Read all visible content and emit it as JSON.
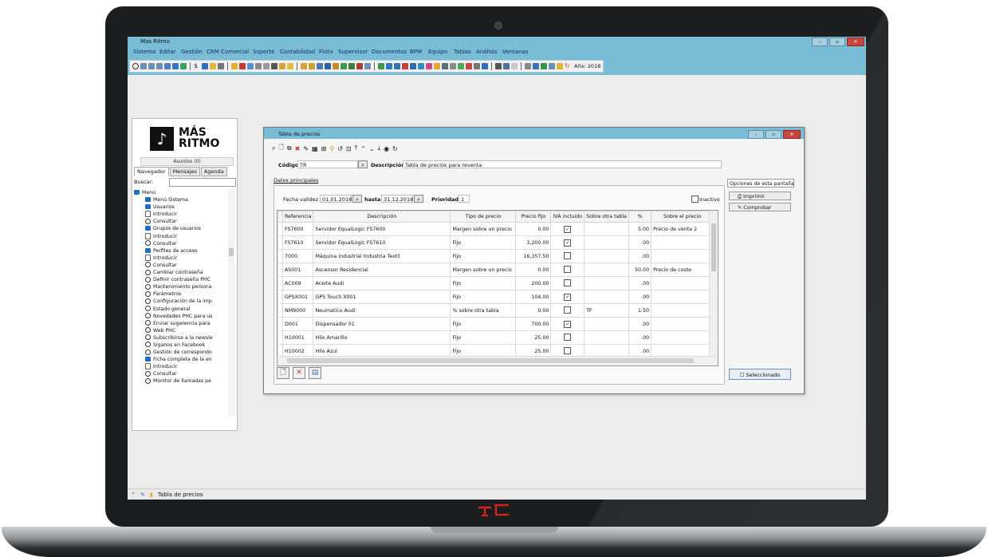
{
  "app": {
    "title": "Mas Ritmo",
    "menu": [
      "Sistema",
      "Editar",
      "Gestión",
      "CRM Comercial",
      "Soporte",
      "Contabilidad",
      "Flota",
      "Supervisor",
      "Documentos",
      "BPM",
      "Equipo",
      "Tablas",
      "Análisis",
      "Ventanas"
    ],
    "year_label": "Año: 2018"
  },
  "nav": {
    "logo_line1": "MÁS",
    "logo_line2": "RITMO",
    "asuntos": "Asuntos (0)",
    "tabs": [
      "Navegador",
      "Mensajes",
      "Agenda"
    ],
    "search_label": "Buscar:",
    "tree": [
      {
        "icon": "menu",
        "label": "Menú"
      },
      {
        "icon": "folder",
        "label": "Menú Sistema"
      },
      {
        "icon": "folder",
        "label": "Usuarios"
      },
      {
        "icon": "doc",
        "label": "Introducir"
      },
      {
        "icon": "circle",
        "label": "Consultar"
      },
      {
        "icon": "folder",
        "label": "Grupos de usuarios"
      },
      {
        "icon": "doc",
        "label": "Introducir"
      },
      {
        "icon": "circle",
        "label": "Consultar"
      },
      {
        "icon": "folder",
        "label": "Perfiles de acceso"
      },
      {
        "icon": "doc",
        "label": "Introducir"
      },
      {
        "icon": "circle",
        "label": "Consultar"
      },
      {
        "icon": "circle",
        "label": "Cambiar contraseña"
      },
      {
        "icon": "circle",
        "label": "Definir contraseña PHC"
      },
      {
        "icon": "circle",
        "label": "Mantenimiento persona"
      },
      {
        "icon": "circle",
        "label": "Parámetros"
      },
      {
        "icon": "circle",
        "label": "Configuración de la imp"
      },
      {
        "icon": "circle",
        "label": "Estado general"
      },
      {
        "icon": "circle",
        "label": "Novedades PHC para us"
      },
      {
        "icon": "circle",
        "label": "Enviar sugerencia para"
      },
      {
        "icon": "circle",
        "label": "Web PHC"
      },
      {
        "icon": "circle",
        "label": "Subscribirse a la newsle"
      },
      {
        "icon": "circle",
        "label": "Síganos en Facebook"
      },
      {
        "icon": "circle",
        "label": "Gestión de correspondo"
      },
      {
        "icon": "folder",
        "label": "Ficha completa de la en"
      },
      {
        "icon": "doc",
        "label": "Introducir"
      },
      {
        "icon": "circle",
        "label": "Consultar"
      },
      {
        "icon": "circle",
        "label": "Monitor de llamadas pe"
      }
    ]
  },
  "dialog": {
    "title": "Tabla de precios",
    "codigo_label": "Código",
    "codigo_value": "TR",
    "descripcion_label": "Descripción",
    "descripcion_value": "Tabla de precios para reventa",
    "tab_label": "Datos principales",
    "fecha_label": "Fecha validez",
    "fecha_desde": "01.01.2018",
    "hasta_label": "hasta",
    "fecha_hasta": "31.12.2018",
    "prioridad_label": "Prioridad",
    "prioridad_value": "1",
    "inactivo_label": "Inactivo",
    "options_label": "Opciones de esta pantalla",
    "imprimir": "Imprimir",
    "comprobar": "Comprobar",
    "seleccionado": "Seleccionado",
    "columns": [
      "Referencia",
      "Descripción",
      "Tipo de precio",
      "Precio fijo",
      "IVA incluido",
      "Sobre otra tabla",
      "%",
      "Sobre el precio"
    ],
    "rows": [
      {
        "ref": "FS7600",
        "desc": "Servidor EqualLogic FS7600",
        "tipo": "Margen sobre un precio",
        "precio": "0.00",
        "iva": true,
        "sobre_tabla": "",
        "pct": "5.00",
        "sobre_precio": "Precio de venta 2"
      },
      {
        "ref": "FS7610",
        "desc": "Servidor EqualLogic FS7610",
        "tipo": "Fijo",
        "precio": "3,200.00",
        "iva": true,
        "sobre_tabla": "",
        "pct": ".00",
        "sobre_precio": ""
      },
      {
        "ref": "7000",
        "desc": "Máquina industrial Industria Textil",
        "tipo": "Fijo",
        "precio": "16,357.50",
        "iva": false,
        "sobre_tabla": "",
        "pct": ".00",
        "sobre_precio": ""
      },
      {
        "ref": "AS001",
        "desc": "Ascensor Residencial",
        "tipo": "Margen sobre un precio",
        "precio": "0.00",
        "iva": false,
        "sobre_tabla": "",
        "pct": "50.00",
        "sobre_precio": "Precio de coste"
      },
      {
        "ref": "AC009",
        "desc": "Aceite Audi",
        "tipo": "Fijo",
        "precio": "200.00",
        "iva": false,
        "sobre_tabla": "",
        "pct": ".00",
        "sobre_precio": ""
      },
      {
        "ref": "GPSX001",
        "desc": "GPS Touch X001",
        "tipo": "Fijo",
        "precio": "104.00",
        "iva": true,
        "sobre_tabla": "",
        "pct": ".00",
        "sobre_precio": ""
      },
      {
        "ref": "NM9000",
        "desc": "Neumatico Audi",
        "tipo": "% sobre otra tabla",
        "precio": "0.00",
        "iva": false,
        "sobre_tabla": "TF",
        "pct": "1.50",
        "sobre_precio": ""
      },
      {
        "ref": "D001",
        "desc": "Dispensador 01",
        "tipo": "Fijo",
        "precio": "700.00",
        "iva": true,
        "sobre_tabla": "",
        "pct": ".00",
        "sobre_precio": ""
      },
      {
        "ref": "H10001",
        "desc": "Hilo Amarillo",
        "tipo": "Fijo",
        "precio": "25.00",
        "iva": false,
        "sobre_tabla": "",
        "pct": ".00",
        "sobre_precio": ""
      },
      {
        "ref": "H10002",
        "desc": "Hilo Azul",
        "tipo": "Fijo",
        "precio": "25.00",
        "iva": false,
        "sobre_tabla": "",
        "pct": ".00",
        "sobre_precio": ""
      }
    ]
  },
  "statusbar": {
    "window_label": "Tabla de precios"
  },
  "colors": {
    "accent": "#78bcd6",
    "folder": "#1f6dbe",
    "close": "#c9463d",
    "brand_logo": "#e0201b"
  }
}
